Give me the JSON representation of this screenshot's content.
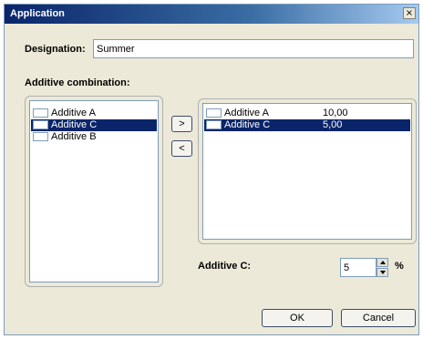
{
  "window": {
    "title": "Application",
    "close_glyph": "×"
  },
  "designation": {
    "label": "Designation:",
    "value": "Summer"
  },
  "additive_combination": {
    "label": "Additive combination:"
  },
  "left_list": {
    "items": [
      {
        "label": "Additive A",
        "selected": false
      },
      {
        "label": "Additive C",
        "selected": true
      },
      {
        "label": "Additive B",
        "selected": false
      }
    ]
  },
  "transfer": {
    "right_label": ">",
    "left_label": "<"
  },
  "right_list": {
    "items": [
      {
        "label": "Additive A",
        "value": "10,00",
        "selected": false
      },
      {
        "label": "Additive C",
        "value": "5,00",
        "selected": true
      }
    ]
  },
  "additive_c": {
    "label": "Additive C:",
    "value": "5",
    "unit": "%"
  },
  "buttons": {
    "ok": "OK",
    "cancel": "Cancel"
  },
  "colors": {
    "selection": "#0a246a",
    "dialog_bg": "#ece9d8",
    "titlebar": "#0a246a"
  }
}
